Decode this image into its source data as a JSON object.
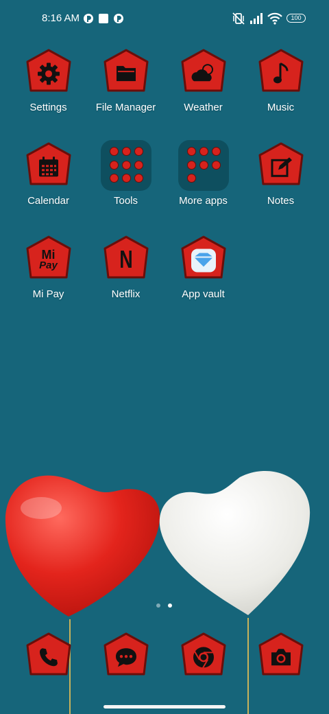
{
  "status_bar": {
    "time": "8:16 AM",
    "battery": "100",
    "left_icons": [
      "notification-icon",
      "square-notification-icon",
      "notification-icon"
    ],
    "right_icons": [
      "vibrate-off-icon",
      "signal-icon",
      "wifi-icon",
      "battery-icon"
    ]
  },
  "apps": [
    {
      "label": "Settings",
      "icon": "gear-icon"
    },
    {
      "label": "File Manager",
      "icon": "folder-icon"
    },
    {
      "label": "Weather",
      "icon": "weather-icon"
    },
    {
      "label": "Music",
      "icon": "music-note-icon"
    },
    {
      "label": "Calendar",
      "icon": "calendar-icon"
    },
    {
      "label": "Tools",
      "icon": "folder-group-icon"
    },
    {
      "label": "More apps",
      "icon": "folder-group-icon"
    },
    {
      "label": "Notes",
      "icon": "notes-edit-icon"
    },
    {
      "label": "Mi Pay",
      "icon": "mi-pay-icon"
    },
    {
      "label": "Netflix",
      "icon": "netflix-icon"
    },
    {
      "label": "App vault",
      "icon": "app-vault-icon"
    }
  ],
  "dock": [
    {
      "icon": "phone-icon"
    },
    {
      "icon": "messages-icon"
    },
    {
      "icon": "chrome-icon"
    },
    {
      "icon": "camera-icon"
    }
  ],
  "mi_pay_logo": {
    "line1": "Mi",
    "line2": "Pay"
  },
  "netflix_logo": "N",
  "page_indicator": {
    "pages": 2,
    "current": 2
  },
  "colors": {
    "background": "#16657a",
    "icon_red": "#d7231d",
    "icon_border": "#6a0e0a"
  },
  "wallpaper": "red and white heart balloons"
}
